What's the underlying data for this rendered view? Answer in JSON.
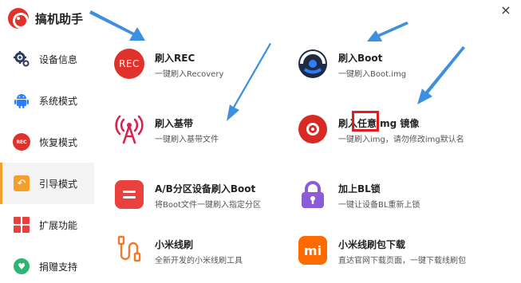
{
  "app": {
    "title": "搞机助手",
    "close": "×"
  },
  "sidebar": {
    "items": [
      {
        "label": "设备信息",
        "icon": "gear-icon"
      },
      {
        "label": "系统模式",
        "icon": "android-icon"
      },
      {
        "label": "恢复模式",
        "icon": "rec-icon"
      },
      {
        "label": "引导模式",
        "icon": "back-arrow-icon"
      },
      {
        "label": "扩展功能",
        "icon": "grid-icon"
      },
      {
        "label": "捐赠支持",
        "icon": "heart-icon"
      }
    ],
    "active": "引导模式"
  },
  "cards": [
    {
      "title": "刷入REC",
      "desc": "一键刷入Recovery",
      "icon": "rec-icon",
      "icon_text": "REC"
    },
    {
      "title": "刷入Boot",
      "desc": "一键刷入Boot.img",
      "icon": "boot-icon"
    },
    {
      "title": "刷入基带",
      "desc": "一键刷入基带文件",
      "icon": "antenna-icon"
    },
    {
      "title": "刷入任意img 镜像",
      "desc": "一键刷入img，请勿修改img默认名",
      "icon": "disc-icon"
    },
    {
      "title": "A/B分区设备刷入Boot",
      "desc": "将Boot文件一键刷入指定分区",
      "icon": "ab-partition-icon"
    },
    {
      "title": "加上BL锁",
      "desc": "一键让设备BL重新上锁",
      "icon": "lock-icon"
    },
    {
      "title": "小米线刷",
      "desc": "全新开发的小米线刷工具",
      "icon": "cable-icon"
    },
    {
      "title": "小米线刷包下载",
      "desc": "直达官网下载页面，一键下载线刷包",
      "icon": "mi-logo-icon",
      "icon_text": "mi"
    }
  ],
  "colors": {
    "accent_red": "#e0322a",
    "active_marker": "#f3a02b",
    "arrow_blue": "#3d8fe0",
    "highlight": "#e21d1d"
  }
}
